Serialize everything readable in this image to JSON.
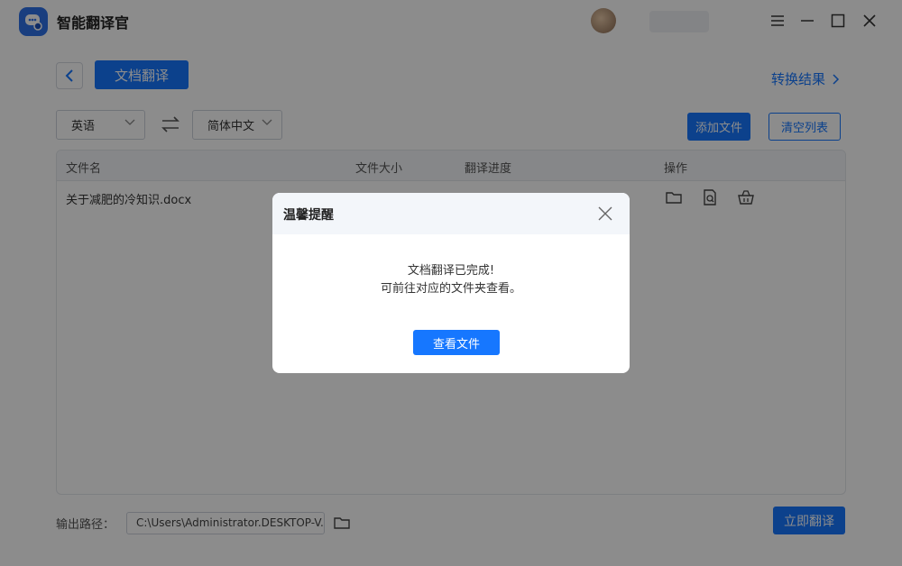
{
  "app": {
    "title": "智能翻译官"
  },
  "nav": {
    "tab_label": "文档翻译",
    "result_link": "转换结果"
  },
  "languages": {
    "source": "英语",
    "target": "简体中文"
  },
  "toolbar": {
    "add_file": "添加文件",
    "clear_list": "清空列表"
  },
  "table": {
    "headers": {
      "name": "文件名",
      "size": "文件大小",
      "progress": "翻译进度",
      "actions": "操作"
    },
    "rows": [
      {
        "name": "关于减肥的冷知识.docx",
        "size": "",
        "progress": ""
      }
    ]
  },
  "output": {
    "label": "输出路径：",
    "path": "C:\\Users\\Administrator.DESKTOP-V..."
  },
  "actions": {
    "start": "立即翻译"
  },
  "dialog": {
    "title": "温馨提醒",
    "line1": "文档翻译已完成!",
    "line2": "可前往对应的文件夹查看。",
    "button": "查看文件"
  },
  "icons": [
    "app-logo-icon",
    "back-arrow-icon",
    "chevron-right-icon",
    "swap-icon",
    "caret-down-icon",
    "folder-icon",
    "preview-icon",
    "delete-basket-icon",
    "minimize-icon",
    "maximize-icon",
    "close-icon",
    "menu-icon"
  ],
  "colors": {
    "accent": "#1677ff",
    "overlay": "rgba(0,0,0,0.45)"
  }
}
